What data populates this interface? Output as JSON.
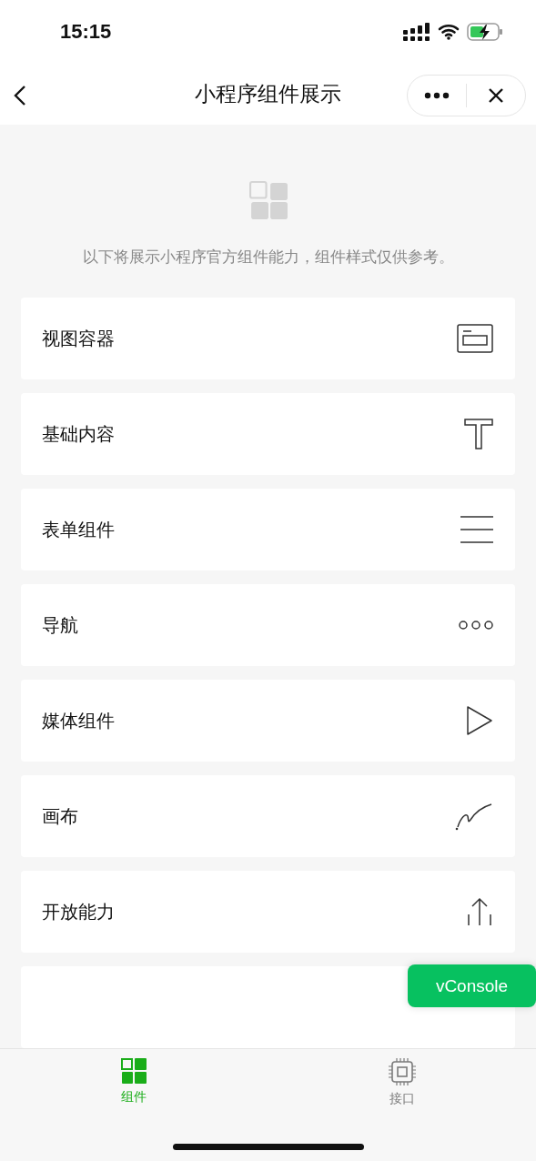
{
  "status_bar": {
    "time": "15:15"
  },
  "nav": {
    "title": "小程序组件展示"
  },
  "intro": "以下将展示小程序官方组件能力，组件样式仅供参考。",
  "items": [
    {
      "label": "视图容器",
      "kind": "view"
    },
    {
      "label": "基础内容",
      "kind": "text"
    },
    {
      "label": "表单组件",
      "kind": "form"
    },
    {
      "label": "导航",
      "kind": "nav"
    },
    {
      "label": "媒体组件",
      "kind": "media"
    },
    {
      "label": "画布",
      "kind": "canvas"
    },
    {
      "label": "开放能力",
      "kind": "open"
    }
  ],
  "floating_button": "vConsole",
  "tabs": [
    {
      "label": "组件",
      "selected": true,
      "kind": "grid"
    },
    {
      "label": "接口",
      "selected": false,
      "kind": "chip"
    }
  ]
}
